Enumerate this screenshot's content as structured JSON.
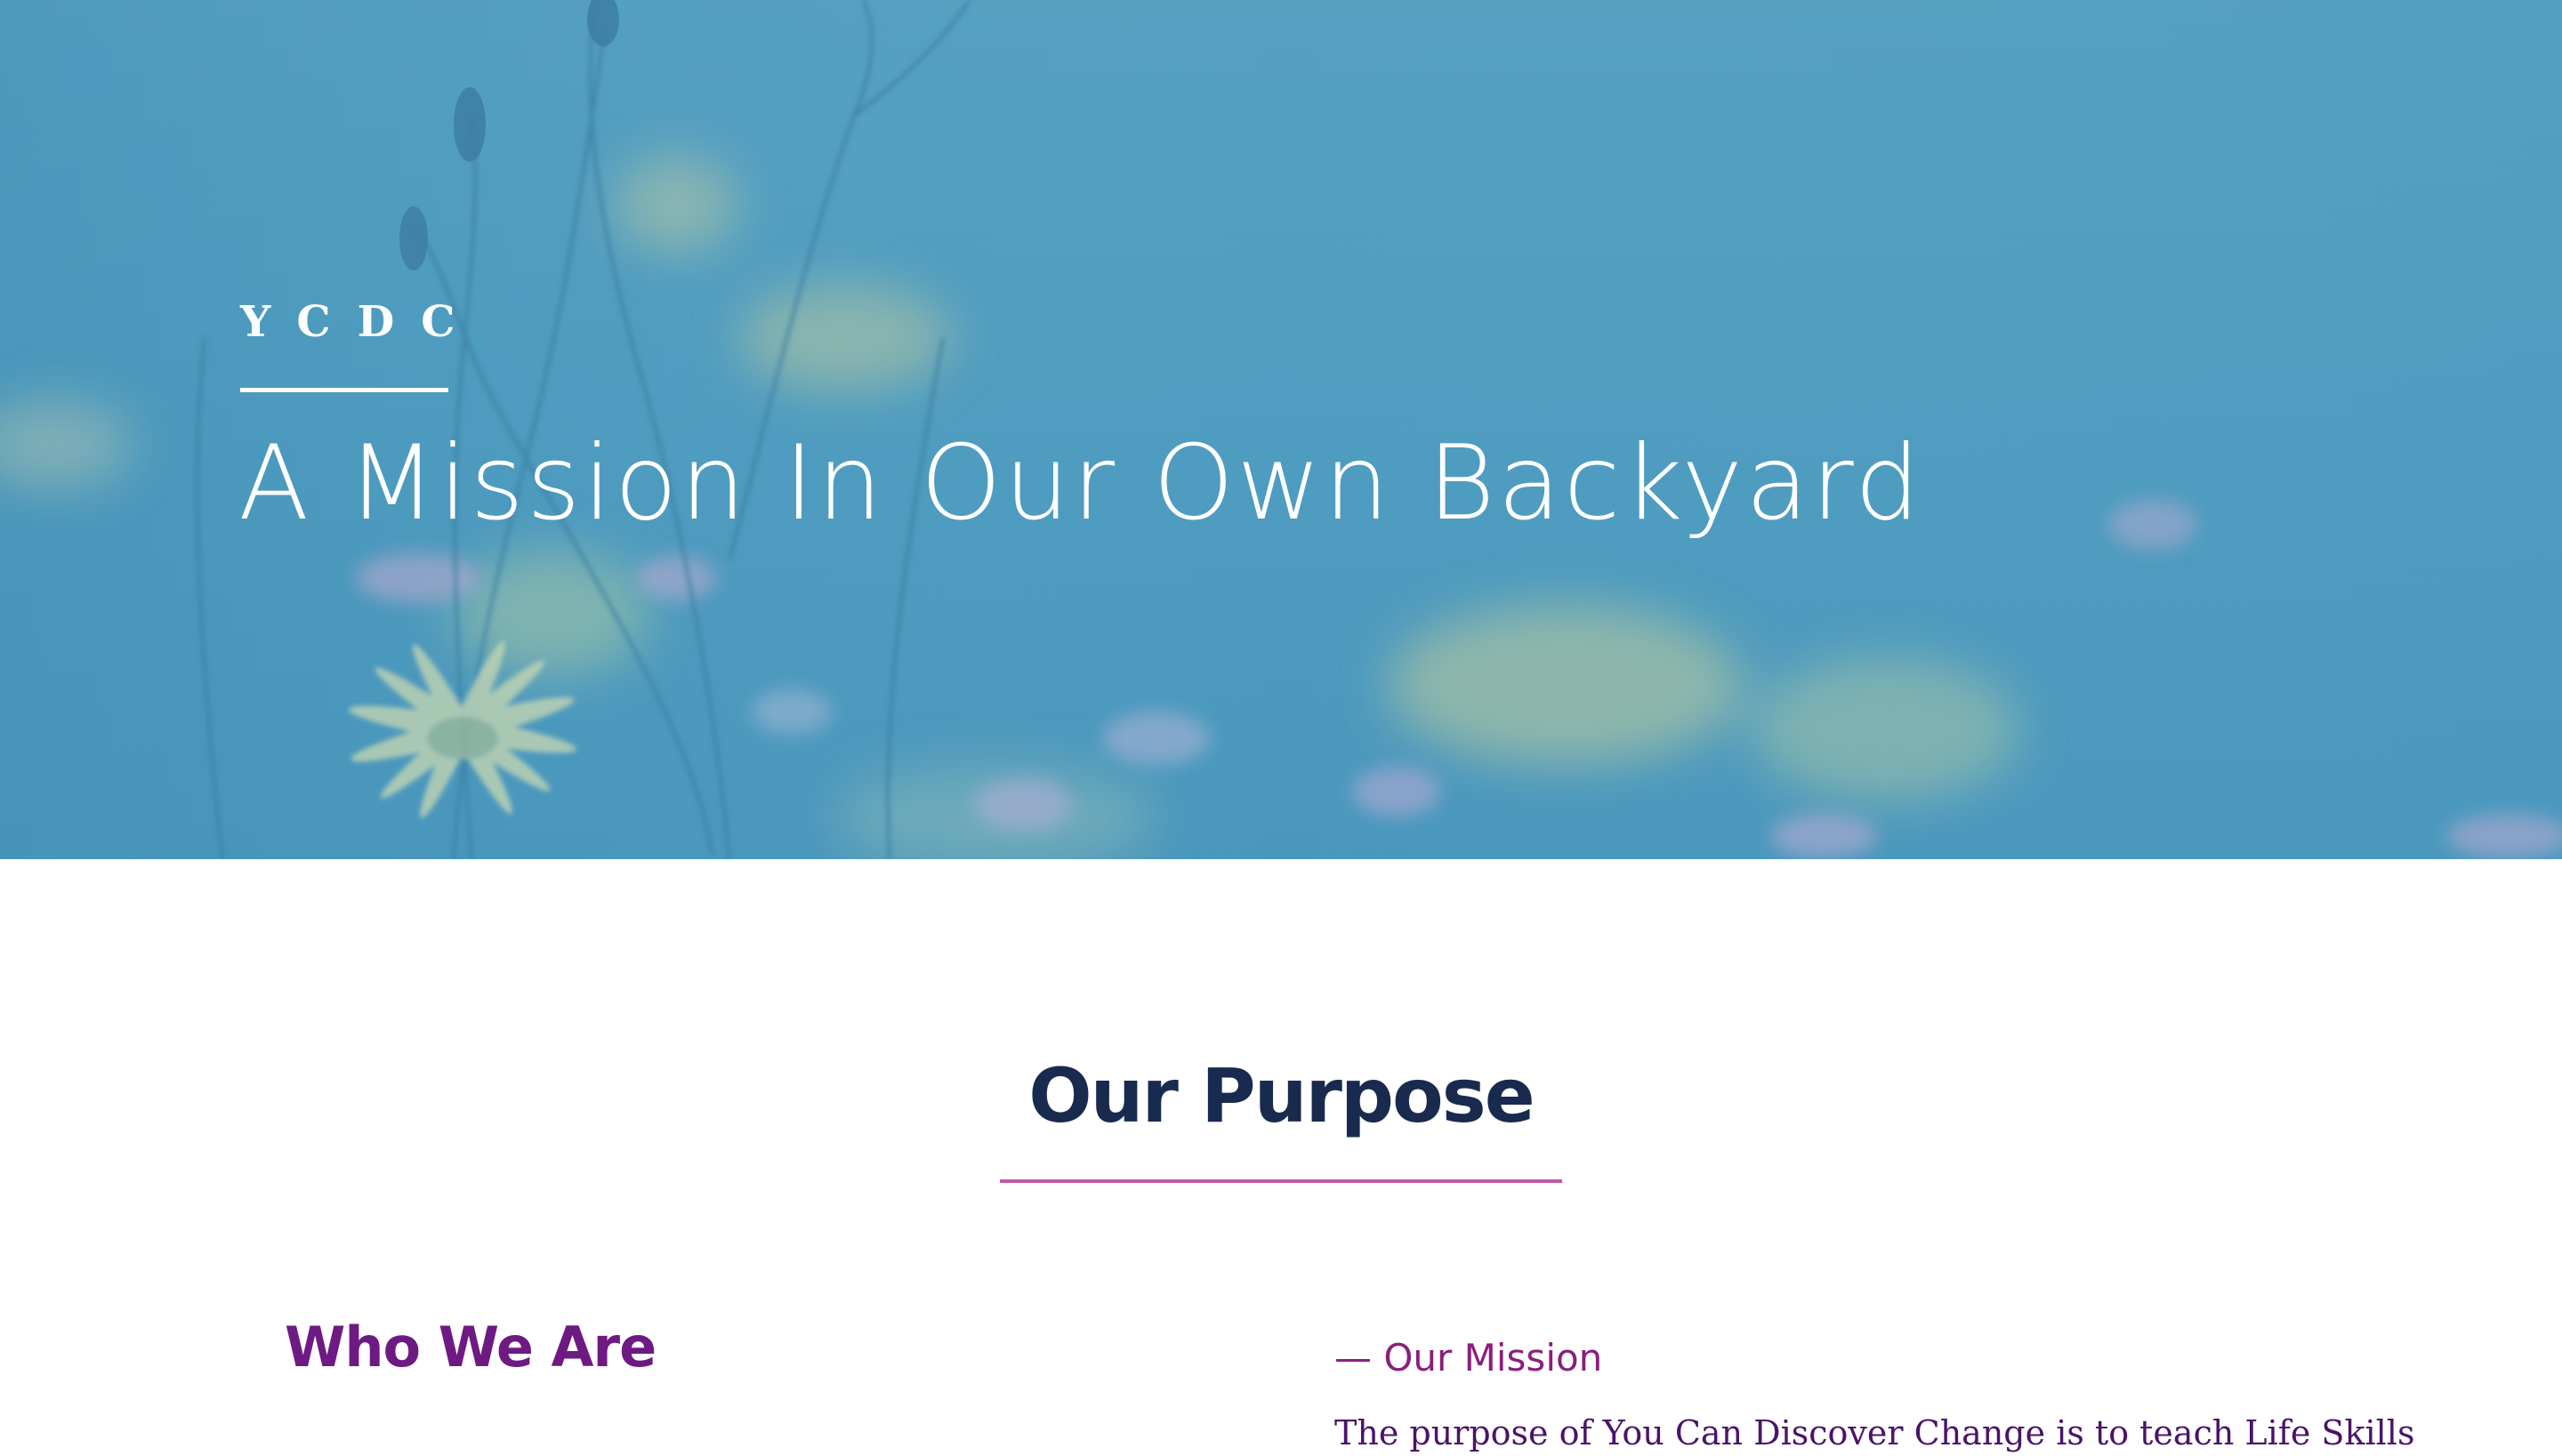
{
  "hero": {
    "brand": "YCDC",
    "title": "A Mission In Our Own Backyard",
    "background_color": "#4f9dc0",
    "background_image": "wildflowers-meadow"
  },
  "purpose": {
    "title": "Our Purpose",
    "underline_color": "#c05aa6",
    "title_color": "#182a4e"
  },
  "who_we_are": {
    "title": "Who We Are",
    "color": "#6e1a83"
  },
  "mission": {
    "label": "— Our Mission",
    "text": "The purpose of You Can Discover Change is to teach Life Skills",
    "label_color": "#8a1f7c",
    "text_color": "#4a1468"
  }
}
